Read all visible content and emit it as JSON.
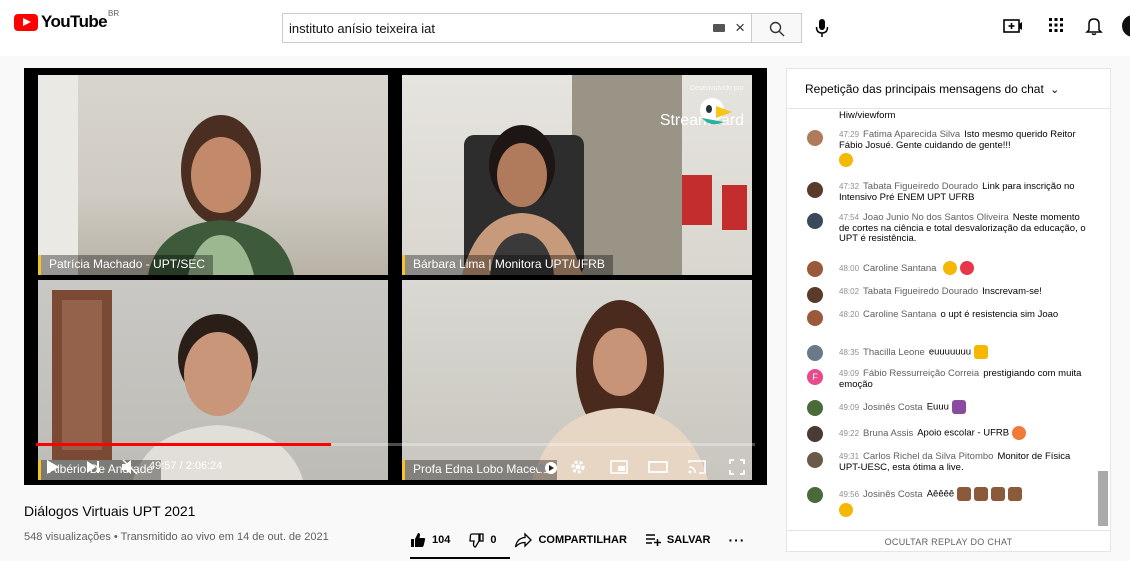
{
  "header": {
    "logo_text": "YouTube",
    "logo_region": "BR",
    "search_value": "instituto anísio teixeira iat"
  },
  "player": {
    "participants": [
      {
        "label": "Patrícia Machado - UPT/SEC"
      },
      {
        "label": "Bárbara Lima | Monitora UPT/UFRB"
      },
      {
        "label": "Albério De Andrade"
      },
      {
        "label": "Profa Edna Lobo Macedo"
      }
    ],
    "watermark_small": "Desenvolvido por",
    "watermark_name": "StreamYard",
    "progress": 0.41,
    "time": "49:57 / 2:06:24"
  },
  "video": {
    "title": "Diálogos Virtuais UPT 2021",
    "meta": "548 visualizações • Transmitido ao vivo em 14 de out. de 2021",
    "likes": "104",
    "dislikes": "0",
    "share_label": "COMPARTILHAR",
    "save_label": "SALVAR",
    "more_label": "···"
  },
  "chat": {
    "header": "Repetição das principais mensagens do chat",
    "footer": "OCULTAR REPLAY DO CHAT",
    "messages": [
      {
        "time": "",
        "author": "",
        "text": "Hiw/viewform"
      },
      {
        "time": "47:29",
        "author": "Fatima Aparecida Silva",
        "text": "Isto mesmo querido Reitor Fábio Josué. Gente cuidando de gente!!!"
      },
      {
        "time": "47:32",
        "author": "Tabata Figueiredo Dourado",
        "text": "Link para inscrição no Intensivo Pré ENEM UPT UFRB"
      },
      {
        "time": "47:54",
        "author": "Joao Junio No dos Santos Oliveira",
        "text": "Neste momento de cortes na ciência e total desvalorização da educação, o UPT é resistência."
      },
      {
        "time": "48:00",
        "author": "Caroline Santana",
        "text": ""
      },
      {
        "time": "48:02",
        "author": "Tabata Figueiredo Dourado",
        "text": "Inscrevam-se!"
      },
      {
        "time": "48:20",
        "author": "Caroline Santana",
        "text": "o upt é resistencia sim Joao"
      },
      {
        "time": "48:35",
        "author": "Thacilla Leone",
        "text": "euuuuuuu"
      },
      {
        "time": "49:09",
        "author": "Fábio Ressurreição Correia",
        "text": "prestigiando com muita emoção"
      },
      {
        "time": "49:09",
        "author": "Josinês Costa",
        "text": "Euuu"
      },
      {
        "time": "49:22",
        "author": "Bruna Assis",
        "text": "Apoio escolar - UFRB"
      },
      {
        "time": "49:31",
        "author": "Carlos Richel da Silva Pitombo",
        "text": "Monitor de Física UPT-UESC, esta ótima a live."
      },
      {
        "time": "49:56",
        "author": "Josinês Costa",
        "text": "Aêêêê"
      }
    ]
  }
}
